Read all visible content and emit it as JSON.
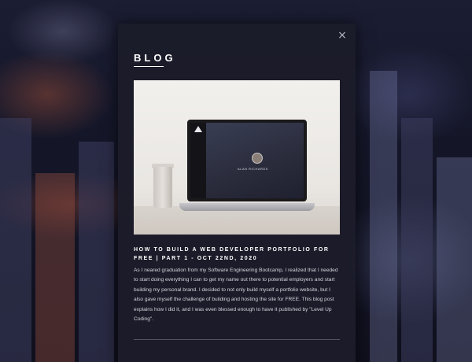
{
  "modal": {
    "close_icon": "×",
    "title": "BLOG"
  },
  "post": {
    "image_alt": "Laptop showing portfolio site",
    "laptop_name": "ALAN RICHARDS",
    "title": "How to Build a Web Developer Portfolio for Free | Part 1 - Oct 22nd, 2020",
    "body": "As I neared graduation from my Software Engineering Bootcamp, I realized that I needed to start doing everything I can to get my name out there to potential employers and start building my personal brand. I decided to not only build myself a portfolio website, but I also gave myself the challenge of building and hosting the site for FREE. This blog post explains how I did it, and I was even blessed enough to have it published by \"Level Up Coding\"."
  }
}
